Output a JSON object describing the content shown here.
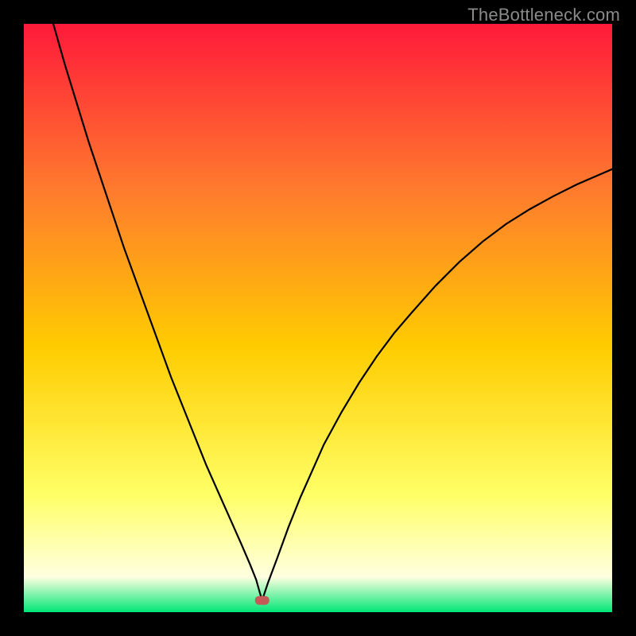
{
  "watermark": "TheBottleneck.com",
  "chart_data": {
    "type": "line",
    "title": "",
    "xlabel": "",
    "ylabel": "",
    "xlim": [
      0,
      100
    ],
    "ylim": [
      0,
      100
    ],
    "background_gradient": {
      "top": "#ff1a3a",
      "mid_upper": "#ff7a2e",
      "mid": "#ffcc00",
      "lower": "#ffff66",
      "near_bottom": "#ffffe0",
      "bottom": "#00e676"
    },
    "annotations": [
      {
        "name": "min-marker",
        "x": 40.5,
        "y": 2,
        "color": "#c45a58"
      }
    ],
    "series": [
      {
        "name": "left-branch",
        "x": [
          5,
          7,
          9,
          11,
          13,
          15,
          17,
          19,
          21,
          23,
          25,
          27,
          29,
          31,
          33,
          35,
          37,
          38.5,
          39.5,
          40,
          40.5
        ],
        "y": [
          100,
          93,
          86.5,
          80,
          74,
          68,
          62,
          56.5,
          51,
          45.5,
          40,
          35,
          30,
          25,
          20.5,
          16,
          11.5,
          8,
          5.5,
          3.7,
          2
        ]
      },
      {
        "name": "right-branch",
        "x": [
          40.5,
          41.5,
          43,
          45,
          47,
          49,
          51,
          54,
          57,
          60,
          63,
          66,
          70,
          74,
          78,
          82,
          86,
          90,
          94,
          97,
          100
        ],
        "y": [
          2,
          5,
          9,
          14.5,
          19.5,
          24,
          28.5,
          34,
          39,
          43.5,
          47.5,
          51,
          55.5,
          59.5,
          63,
          66,
          68.5,
          70.7,
          72.7,
          74,
          75.3
        ]
      }
    ]
  }
}
